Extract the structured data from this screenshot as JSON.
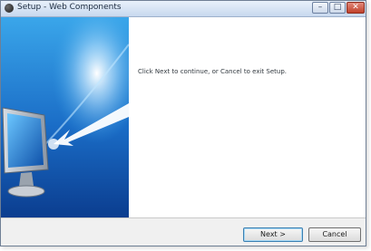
{
  "window": {
    "title": "Setup - Web Components",
    "minimize_glyph": "–",
    "maximize_glyph": "□",
    "close_glyph": "✕"
  },
  "content": {
    "message": "Click Next to continue, or Cancel to exit Setup."
  },
  "footer": {
    "next_label": "Next >",
    "cancel_label": "Cancel"
  },
  "icons": [
    "app-icon",
    "minimize-icon",
    "maximize-icon",
    "close-icon",
    "monitor-illustration"
  ],
  "colors": {
    "banner_top": "#3aa6ea",
    "banner_bottom": "#0b3d8f",
    "close_button": "#c0402a"
  }
}
